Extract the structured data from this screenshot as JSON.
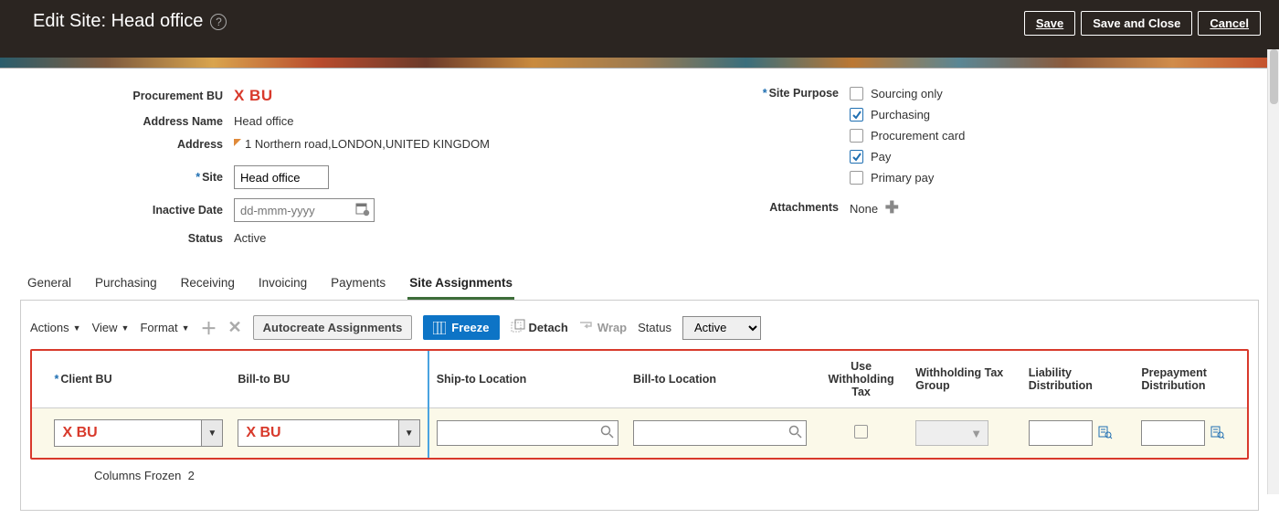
{
  "header": {
    "title": "Edit Site: Head office",
    "buttons": {
      "save": "Save",
      "save_close": "Save and Close",
      "cancel": "Cancel"
    }
  },
  "form": {
    "procurement_bu_label": "Procurement BU",
    "procurement_bu_value": "X BU",
    "address_name_label": "Address Name",
    "address_name_value": "Head office",
    "address_label": "Address",
    "address_value": "1 Northern road,LONDON,UNITED KINGDOM",
    "site_label": "Site",
    "site_value": "Head office",
    "inactive_date_label": "Inactive Date",
    "inactive_date_placeholder": "dd-mmm-yyyy",
    "status_label": "Status",
    "status_value": "Active",
    "site_purpose_label": "Site Purpose",
    "site_purpose_options": {
      "sourcing_only": "Sourcing only",
      "purchasing": "Purchasing",
      "procurement_card": "Procurement card",
      "pay": "Pay",
      "primary_pay": "Primary pay"
    },
    "attachments_label": "Attachments",
    "attachments_value": "None"
  },
  "tabs": {
    "general": "General",
    "purchasing": "Purchasing",
    "receiving": "Receiving",
    "invoicing": "Invoicing",
    "payments": "Payments",
    "site_assignments": "Site Assignments"
  },
  "toolbar": {
    "actions": "Actions",
    "view": "View",
    "format": "Format",
    "autocreate": "Autocreate Assignments",
    "freeze": "Freeze",
    "detach": "Detach",
    "wrap": "Wrap",
    "status_label": "Status",
    "status_value": "Active"
  },
  "grid": {
    "headers": {
      "client_bu": "Client BU",
      "bill_to_bu": "Bill-to BU",
      "ship_to_location": "Ship-to Location",
      "bill_to_location": "Bill-to Location",
      "use_withholding_tax": "Use Withholding Tax",
      "withholding_tax_group": "Withholding Tax Group",
      "liability_distribution": "Liability Distribution",
      "prepayment_distribution": "Prepayment Distribution"
    },
    "row": {
      "client_bu": "X BU",
      "bill_to_bu": "X BU",
      "ship_to_location": "",
      "bill_to_location": "",
      "liability_distribution": "",
      "prepayment_distribution": ""
    },
    "frozen_note": "Columns Frozen",
    "frozen_count": "2"
  }
}
